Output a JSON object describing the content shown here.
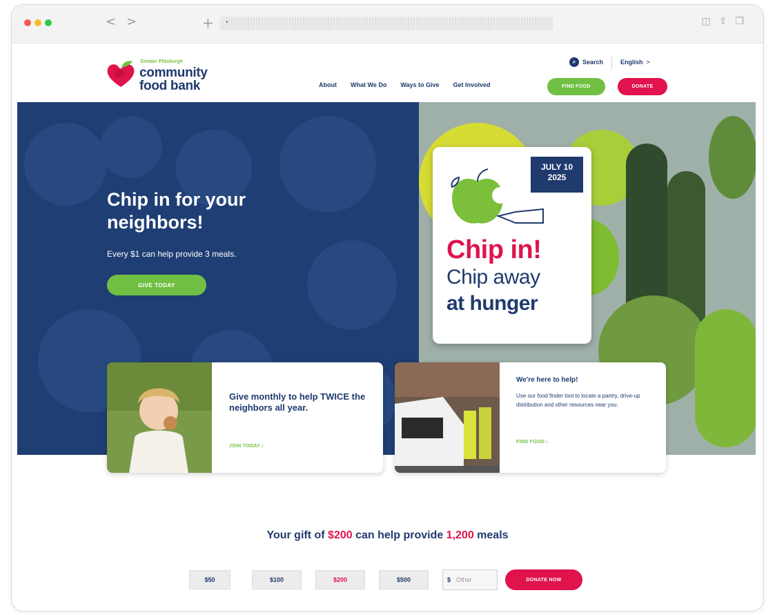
{
  "browser": {
    "back": "<",
    "forward": ">",
    "new_tab": "+",
    "lock": "🔒"
  },
  "logo": {
    "small": "Greater Pittsburgh",
    "line1": "community",
    "line2": "food bank"
  },
  "utility": {
    "search": "Search",
    "language": "English",
    "lang_chevron": ">"
  },
  "nav": {
    "about": "About",
    "what_we_do": "What We Do",
    "ways_to_give": "Ways to Give",
    "get_involved": "Get Involved",
    "find_food": "FIND FOOD",
    "donate": "DONATE"
  },
  "hero": {
    "title_1": "Chip in for your",
    "title_2": "neighbors!",
    "subtitle": "Every $1 can help provide 3 meals.",
    "cta": "GIVE TODAY"
  },
  "promo": {
    "date_1": "JULY 10",
    "date_2": "2025",
    "line1": "Chip in!",
    "line2": "Chip away",
    "line3": "at hunger"
  },
  "cards": [
    {
      "text": "Give monthly to help TWICE the neighbors all year.",
      "link": "JOIN TODAY ›"
    },
    {
      "title": "We're here to help!",
      "desc": "Use our food finder tool to locate a pantry, drive-up distribution and other resources near you.",
      "link": "FIND FOOD ›"
    }
  ],
  "gift": {
    "pre": "Your gift of ",
    "amount": "$200",
    "mid": " can help provide ",
    "meals": "1,200",
    "post": " meals"
  },
  "amounts": [
    "$50",
    "$100",
    "$200",
    "$500"
  ],
  "other": {
    "currency": "$",
    "placeholder": "Other"
  },
  "donate_now": "DONATE NOW",
  "colors": {
    "navy": "#1f3a6d",
    "green": "#72c043",
    "red": "#e0134c"
  }
}
